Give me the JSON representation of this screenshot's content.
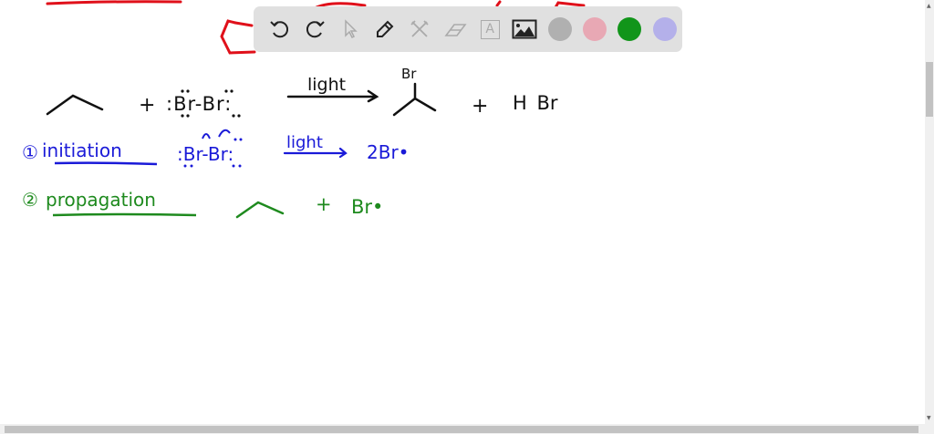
{
  "toolbar": {
    "tools": [
      {
        "name": "undo",
        "icon": "undo-icon"
      },
      {
        "name": "redo",
        "icon": "redo-icon"
      },
      {
        "name": "select",
        "icon": "cursor-icon"
      },
      {
        "name": "pen",
        "icon": "pencil-icon"
      },
      {
        "name": "tools",
        "icon": "tools-icon"
      },
      {
        "name": "eraser",
        "icon": "eraser-icon"
      },
      {
        "name": "text",
        "icon": "text-box-icon",
        "label": "A"
      },
      {
        "name": "image",
        "icon": "image-icon"
      }
    ],
    "colors": [
      "#b0b0b0",
      "#e8a8b4",
      "#11951a",
      "#b4b0ea"
    ]
  },
  "board": {
    "colors": {
      "black": "#111111",
      "blue": "#1a1ad8",
      "green": "#1e8a1e",
      "red": "#e0101a"
    },
    "reaction": {
      "reagent": ":Br-Br:",
      "plus1": "+",
      "condition": "light",
      "product_sub": "Br",
      "plus2": "+",
      "byproduct": "H Br"
    },
    "initiation": {
      "number": "①",
      "label": "initiation",
      "reagent": ":Br-Br:",
      "condition": "light",
      "product": "2Br•"
    },
    "propagation": {
      "number": "②",
      "label": "propagation",
      "plus": "+",
      "radical": "Br•"
    }
  }
}
